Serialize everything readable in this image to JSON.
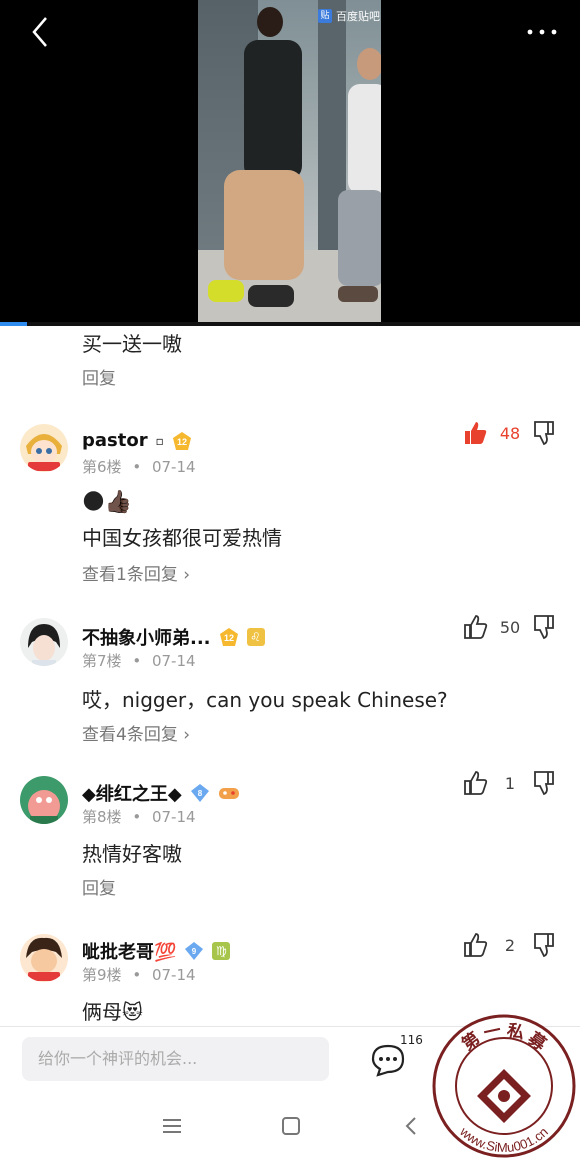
{
  "video": {
    "logo_text": "百度贴吧",
    "progress": 0.047
  },
  "partial_comment": {
    "text": "买一送一嗷",
    "reply_label": "回复"
  },
  "comments": [
    {
      "username": "pastor",
      "user_mark": "▫",
      "level": "12",
      "floor": "第6楼",
      "date": "07-14",
      "separator": "•",
      "emoji_line": "🌑👍🏿",
      "text": "中国女孩都很可爱热情",
      "reply_label": "查看1条回复",
      "likes": "48",
      "liked": true
    },
    {
      "username": "不抽象小师弟...",
      "level": "12",
      "tag": "♌",
      "floor": "第7楼",
      "date": "07-14",
      "separator": "•",
      "text": "哎，nigger，can you speak Chinese?",
      "reply_label": "查看4条回复",
      "likes": "50",
      "liked": false
    },
    {
      "username": "◆绯红之王◆",
      "level": "8",
      "tag_icon": "gamepad-icon",
      "floor": "第8楼",
      "date": "07-14",
      "separator": "•",
      "text": "热情好客嗷",
      "reply_label": "回复",
      "likes": "1",
      "liked": false
    },
    {
      "username": "呲批老哥💯",
      "level": "9",
      "tag": "♍",
      "floor": "第9楼",
      "date": "07-14",
      "separator": "•",
      "text": "俩母😻",
      "likes": "2",
      "liked": false
    }
  ],
  "input": {
    "placeholder": "给你一个神评的机会..."
  },
  "comment_count": "116",
  "watermark": {
    "text_top": "第 一 私 募",
    "text_bottom": "www.SiMu001.cn"
  },
  "colors": {
    "liked": "#e8412e",
    "level_badge": "#f5b82e",
    "diamond_blue": "#6aa8f0",
    "progress": "#2e8cf0"
  }
}
